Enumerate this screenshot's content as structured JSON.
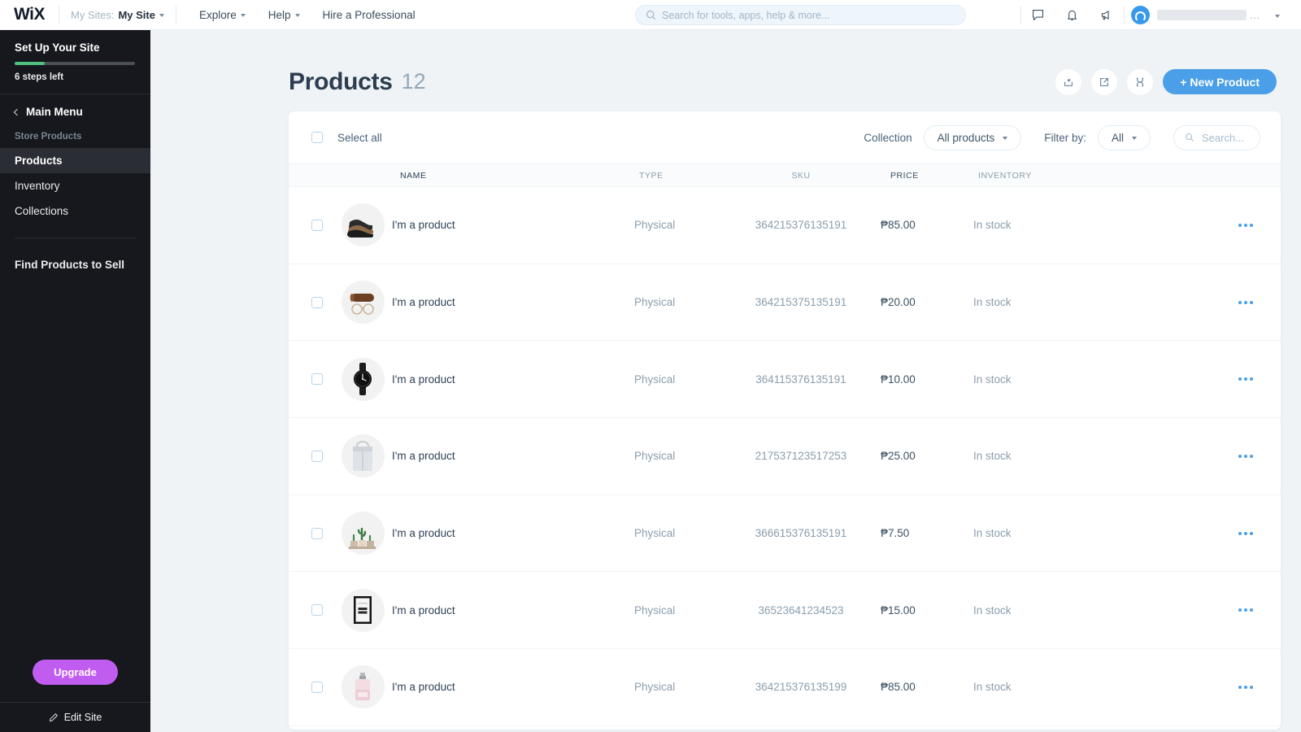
{
  "topbar": {
    "logo": "WiX",
    "mysites_label": "My Sites:",
    "mysites_value": "My Site",
    "menu": [
      {
        "label": "Explore",
        "caret": true
      },
      {
        "label": "Help",
        "caret": true
      },
      {
        "label": "Hire a Professional",
        "caret": false
      }
    ],
    "search_placeholder": "Search for tools, apps, help & more...",
    "icons": [
      "chat-icon",
      "bell-icon",
      "megaphone-icon"
    ],
    "user_menu_dots": "..."
  },
  "sidebar": {
    "setup_title": "Set Up Your Site",
    "progress_percent": 25,
    "steps_left": "6 steps left",
    "main_menu": "Main Menu",
    "group_title": "Store Products",
    "items": [
      {
        "label": "Products",
        "active": true
      },
      {
        "label": "Inventory",
        "active": false
      },
      {
        "label": "Collections",
        "active": false
      }
    ],
    "find_products": "Find Products to Sell",
    "upgrade_label": "Upgrade",
    "edit_site_label": "Edit Site",
    "upgrade_color": "#c15cf0",
    "progress_color": "#4fc27e"
  },
  "page": {
    "title": "Products",
    "count": "12",
    "actions": [
      {
        "name": "import-button",
        "icon": "import-icon"
      },
      {
        "name": "export-button",
        "icon": "export-icon"
      },
      {
        "name": "sync-button",
        "icon": "sync-icon"
      }
    ],
    "new_product_label": "+ New Product",
    "accent_color": "#4a9fe8"
  },
  "toolbar": {
    "select_all_label": "Select all",
    "collection_label": "Collection",
    "collection_value": "All products",
    "filter_label": "Filter by:",
    "filter_value": "All",
    "search_placeholder": "Search..."
  },
  "table": {
    "columns": [
      "NAME",
      "TYPE",
      "SKU",
      "PRICE",
      "INVENTORY"
    ],
    "rows": [
      {
        "name": "I'm a product",
        "type": "Physical",
        "sku": "364215376135191",
        "price": "₱85.00",
        "inventory": "In stock",
        "thumb": "shoes-thumbnail"
      },
      {
        "name": "I'm a product",
        "type": "Physical",
        "sku": "364215375135191",
        "price": "₱20.00",
        "inventory": "In stock",
        "thumb": "glasses-case-thumbnail"
      },
      {
        "name": "I'm a product",
        "type": "Physical",
        "sku": "364115376135191",
        "price": "₱10.00",
        "inventory": "In stock",
        "thumb": "watch-thumbnail"
      },
      {
        "name": "I'm a product",
        "type": "Physical",
        "sku": "217537123517253",
        "price": "₱25.00",
        "inventory": "In stock",
        "thumb": "bag-thumbnail"
      },
      {
        "name": "I'm a product",
        "type": "Physical",
        "sku": "366615376135191",
        "price": "₱7.50",
        "inventory": "In stock",
        "thumb": "cactus-thumbnail"
      },
      {
        "name": "I'm a product",
        "type": "Physical",
        "sku": "36523641234523",
        "price": "₱15.00",
        "inventory": "In stock",
        "thumb": "poster-thumbnail"
      },
      {
        "name": "I'm a product",
        "type": "Physical",
        "sku": "364215376135199",
        "price": "₱85.00",
        "inventory": "In stock",
        "thumb": "perfume-thumbnail"
      }
    ]
  }
}
